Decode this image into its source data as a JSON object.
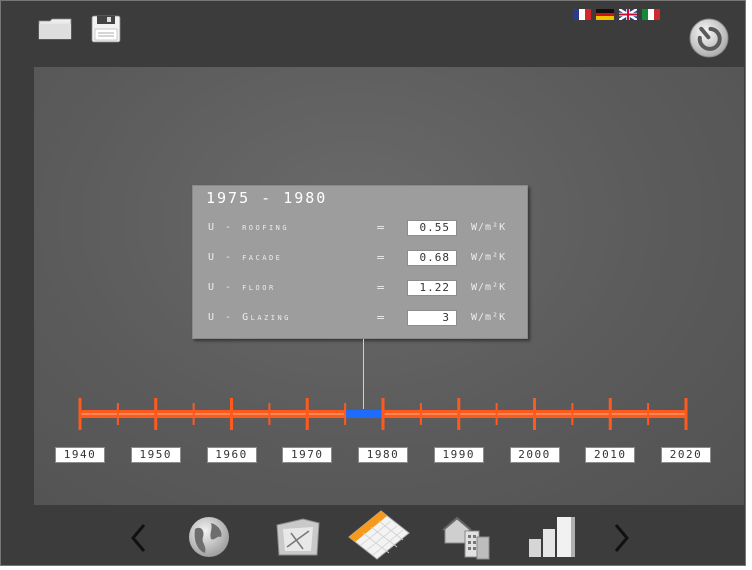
{
  "toolbar": {
    "icons": [
      "folder-icon",
      "save-icon",
      "power-icon"
    ]
  },
  "languages": [
    {
      "code": "fr",
      "icon": "flag-france-icon",
      "colors": [
        "#2b3b8f",
        "#ffffff",
        "#d6262c"
      ]
    },
    {
      "code": "de",
      "icon": "flag-germany-icon",
      "colors": [
        "#111111",
        "#cc1414",
        "#f2c200"
      ]
    },
    {
      "code": "en",
      "icon": "flag-uk-icon",
      "colors": [
        "#1f3a8a",
        "#ffffff",
        "#c8102e"
      ]
    },
    {
      "code": "it",
      "icon": "flag-italy-icon",
      "colors": [
        "#138a3a",
        "#ffffff",
        "#cd2a30"
      ]
    }
  ],
  "panel": {
    "period": "1975 - 1980",
    "rows": [
      {
        "label": "U - roofing",
        "eq": "=",
        "value": "0.55",
        "unit": "W/m²K"
      },
      {
        "label": "U - facade",
        "eq": "=",
        "value": "0.68",
        "unit": "W/m²K"
      },
      {
        "label": "U - floor",
        "eq": "=",
        "value": "1.22",
        "unit": "W/m²K"
      },
      {
        "label": "U - Glazing",
        "eq": "=",
        "value": "3",
        "unit": "W/m²K"
      }
    ]
  },
  "timeline": {
    "years": [
      "1940",
      "1950",
      "1960",
      "1970",
      "1980",
      "1990",
      "2000",
      "2010",
      "2020"
    ],
    "selected_start": 1975,
    "selected_end": 1980,
    "bar_color": "#ff5a1e",
    "selected_color": "#1e6cff"
  },
  "bottom_nav": {
    "icons": [
      "chevron-left-icon",
      "globe-icon",
      "blueprint-icon",
      "calendar-icon",
      "buildings-icon",
      "bar-chart-icon",
      "chevron-right-icon"
    ],
    "active": "calendar-icon"
  }
}
